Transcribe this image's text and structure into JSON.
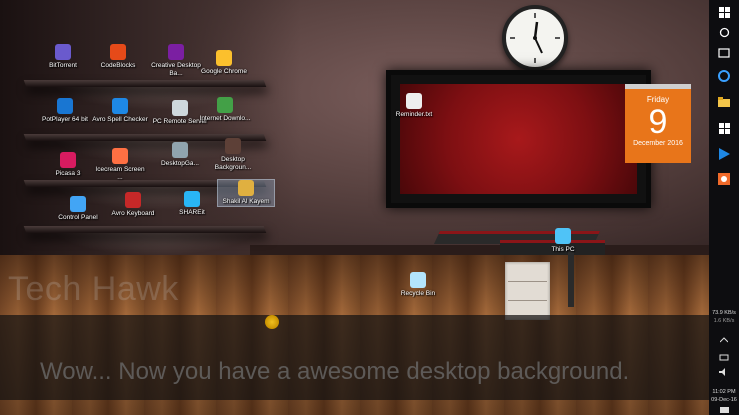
{
  "desktop": {
    "icons": [
      {
        "label": "BitTorrent",
        "icon": "bittorrent-icon",
        "color": "#6a5acd"
      },
      {
        "label": "CodeBlocks",
        "icon": "codeblocks-icon",
        "color": "#e64a19"
      },
      {
        "label": "Creative Desktop Ba...",
        "icon": "creative-desktop-icon",
        "color": "#7b1fa2"
      },
      {
        "label": "Google Chrome",
        "icon": "chrome-icon",
        "color": "#fbc02d"
      },
      {
        "label": "PotPlayer 64 bit",
        "icon": "potplayer-icon",
        "color": "#1976d2"
      },
      {
        "label": "Avro Spell Checker",
        "icon": "avro-spell-icon",
        "color": "#1e88e5"
      },
      {
        "label": "PC Remote Server",
        "icon": "pc-remote-icon",
        "color": "#cfd8dc"
      },
      {
        "label": "Internet Downlo...",
        "icon": "idm-icon",
        "color": "#43a047"
      },
      {
        "label": "Picasa 3",
        "icon": "picasa-icon",
        "color": "#d81b60"
      },
      {
        "label": "Icecream Screen ...",
        "icon": "icecream-icon",
        "color": "#ff7043"
      },
      {
        "label": "DesktopGa...",
        "icon": "desktop-gadgets-icon",
        "color": "#90a4ae"
      },
      {
        "label": "Desktop Backgroun...",
        "icon": "desktop-background-icon",
        "color": "#5d4037"
      },
      {
        "label": "Control Panel",
        "icon": "control-panel-icon",
        "color": "#42a5f5"
      },
      {
        "label": "Avro Keyboard",
        "icon": "avro-keyboard-icon",
        "color": "#c62828"
      },
      {
        "label": "SHAREit",
        "icon": "shareit-icon",
        "color": "#29b6f6"
      },
      {
        "label": "Shakil Al Kayem",
        "icon": "folder-icon",
        "color": "#e0b040"
      },
      {
        "label": "Reminder.txt",
        "icon": "text-file-icon",
        "color": "#eeeeee"
      },
      {
        "label": "This PC",
        "icon": "this-pc-icon",
        "color": "#4fc3f7"
      },
      {
        "label": "Recycle Bin",
        "icon": "recycle-bin-icon",
        "color": "#b3e5fc"
      }
    ],
    "calendar": {
      "weekday": "Friday",
      "day": "9",
      "month_year": "December 2016"
    },
    "watermark": "Tech Hawk",
    "subtitle": "Wow... Now you have a awesome desktop background."
  },
  "taskbar": {
    "buttons": [
      {
        "name": "start-button",
        "icon": "windows-logo-icon"
      },
      {
        "name": "search-button",
        "icon": "search-circle-icon"
      },
      {
        "name": "task-view-button",
        "icon": "task-view-icon"
      },
      {
        "name": "edge-button",
        "icon": "edge-icon"
      },
      {
        "name": "file-explorer-button",
        "icon": "folder-icon"
      },
      {
        "name": "store-button",
        "icon": "store-icon"
      },
      {
        "name": "media-player-button",
        "icon": "play-icon"
      },
      {
        "name": "app-button",
        "icon": "orange-app-icon"
      }
    ],
    "network_up": "73.9 KB/s",
    "network_down": "1.6 KB/s",
    "time": "11:02 PM",
    "date": "09-Dec-16"
  }
}
